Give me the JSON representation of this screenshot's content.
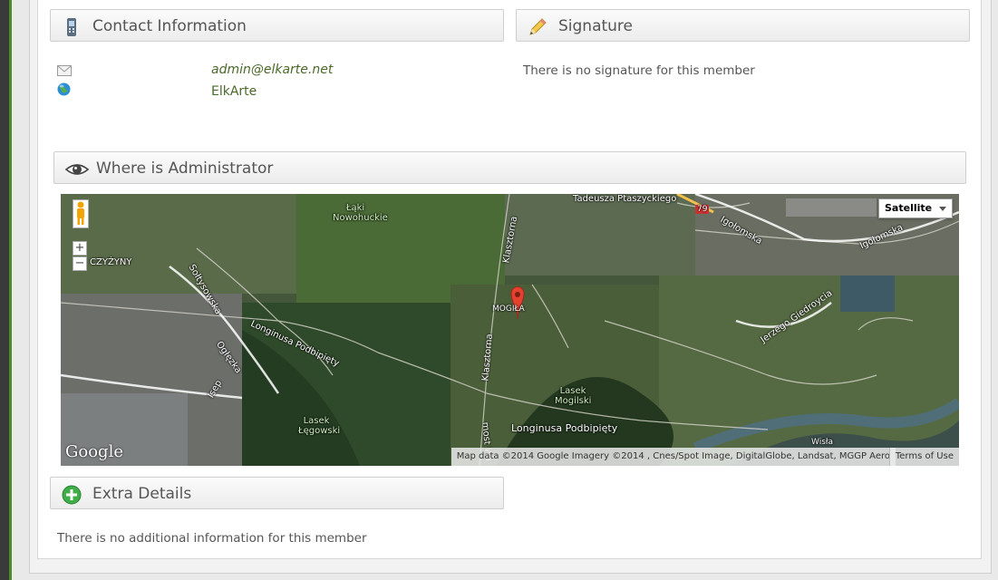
{
  "contact": {
    "title": "Contact Information",
    "email": "admin@elkarte.net",
    "website": "ElkArte"
  },
  "signature": {
    "title": "Signature",
    "text": "There is no signature for this member"
  },
  "location": {
    "title": "Where is Administrator",
    "map": {
      "type_selected": "Satellite",
      "zoom_in": "+",
      "zoom_out": "−",
      "logo": "Google",
      "attribution": "Map data ©2014 Google Imagery ©2014 , Cnes/Spot Image, DigitalGlobe, Landsat, MGGP Aero",
      "terms": "Terms of Use",
      "labels": {
        "tadeusza": "Tadeusza Ptaszyckiego",
        "route79": "79",
        "igolomska1": "Igołomska",
        "igolomska2": "Igołomska",
        "laki": "Łąki Nowohuckie",
        "czyzyny": "CZYŻYNY",
        "soltysowska": "Sołtysowska",
        "longinusa1": "Longinusa Podbipięty",
        "longinusa2": "Longinusa Podbipięty",
        "ogledzka": "Ogłęzka",
        "isep": "Isep",
        "klasztorna1": "Klasztorna",
        "klasztorna2": "Klasztorna",
        "mogila": "MOGIŁA",
        "lasek_mogilski": "Lasek Mogilski",
        "lasek_legowski": "Lasek Łęgowski",
        "jerzego": "Jerzego Giedroycia",
        "most": "most Wa",
        "wisla": "Wisła"
      }
    }
  },
  "extra": {
    "title": "Extra Details",
    "text": "There is no additional information for this member"
  },
  "colors": {
    "accent_green": "#4f8a2b",
    "pin_red": "#e4412f"
  }
}
